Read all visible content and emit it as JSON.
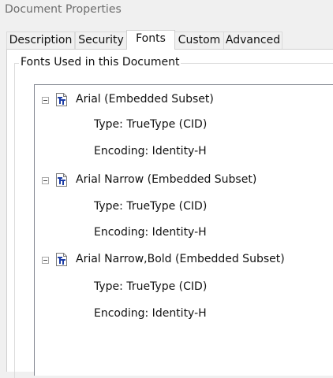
{
  "window": {
    "title": "Document Properties"
  },
  "tabs": [
    {
      "label": "Description"
    },
    {
      "label": "Security"
    },
    {
      "label": "Fonts"
    },
    {
      "label": "Custom"
    },
    {
      "label": "Advanced"
    }
  ],
  "active_tab": "Fonts",
  "fonts_group": {
    "legend": "Fonts Used in this Document",
    "fonts": [
      {
        "name": "Arial (Embedded Subset)",
        "type": "Type: TrueType (CID)",
        "encoding": "Encoding: Identity-H",
        "icon": "truetype-font-icon",
        "expanded": true
      },
      {
        "name": "Arial Narrow (Embedded Subset)",
        "type": "Type: TrueType (CID)",
        "encoding": "Encoding: Identity-H",
        "icon": "truetype-font-icon",
        "expanded": true
      },
      {
        "name": "Arial Narrow,Bold (Embedded Subset)",
        "type": "Type: TrueType (CID)",
        "encoding": "Encoding: Identity-H",
        "icon": "truetype-font-icon",
        "expanded": true
      }
    ]
  },
  "colors": {
    "icon_blue": "#1f3fa6"
  }
}
